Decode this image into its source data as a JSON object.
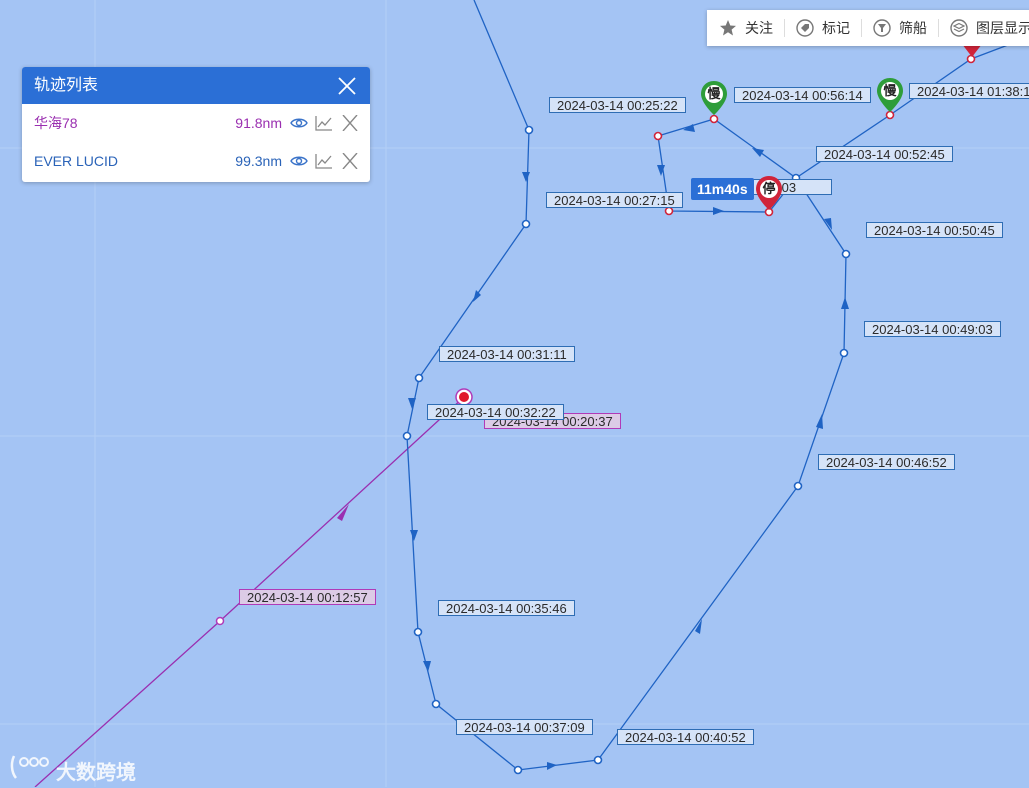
{
  "panel": {
    "title": "轨迹列表",
    "tracks": [
      {
        "name": "华海78",
        "distance": "91.8nm",
        "color": "#9a2fb0"
      },
      {
        "name": "EVER LUCID",
        "distance": "99.3nm",
        "color": "#2a63b8"
      }
    ]
  },
  "toolbar": {
    "follow": "关注",
    "mark": "标记",
    "filter": "筛船",
    "layers": "图层显示"
  },
  "map_labels": {
    "t_0025_22": "2024-03-14 00:25:22",
    "t_0027_15": "2024-03-14 00:27:15",
    "t_0031_11": "2024-03-14 00:31:11",
    "t_0032_22": "2024-03-14 00:32:22",
    "t_0020_37": "2024-03-14 00:20:37",
    "t_0012_57": "2024-03-14 00:12:57",
    "t_0035_46": "2024-03-14 00:35:46",
    "t_0037_09": "2024-03-14 00:37:09",
    "t_0040_52": "2024-03-14 00:40:52",
    "t_0046_52": "2024-03-14 00:46:52",
    "t_0049_03": "2024-03-14 00:49:03",
    "t_0050_45": "2024-03-14 00:50:45",
    "t_0052_45": "2024-03-14 00:52:45",
    "t_0056_14": "2024-03-14 00:56:14",
    "t_0138": "2024-03-14 01:38:1",
    "t_partial": ":05:03"
  },
  "markers": {
    "slow": "慢",
    "stop": "停",
    "stop_duration": "11m40s"
  },
  "watermark": "大数跨境"
}
